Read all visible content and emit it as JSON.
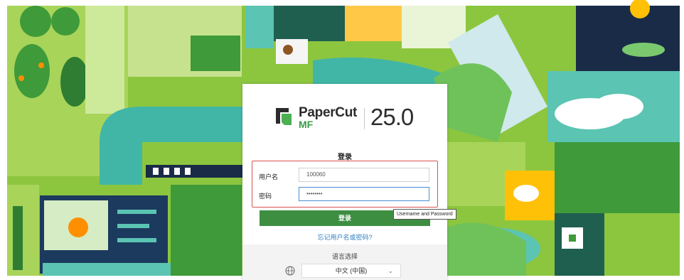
{
  "brand": {
    "name": "PaperCut",
    "sub": "MF",
    "version": "25.0"
  },
  "login": {
    "title": "登录",
    "username_label": "用户名",
    "username_value": "100060",
    "password_label": "密码",
    "password_value": "••••••••",
    "submit_label": "登录",
    "forgot_link": "忘记用户名或密码?"
  },
  "language": {
    "title": "语言选择",
    "selected": "中文 (中国)"
  },
  "tooltip": {
    "text": "Username and Password"
  },
  "colors": {
    "primary_green": "#3e8e41",
    "link_blue": "#2d7fc0",
    "highlight_red": "#d9534f",
    "focus_blue": "#4a8fd8"
  },
  "icons": [
    "papercut-logo-icon",
    "globe-icon",
    "chevron-down-icon"
  ]
}
